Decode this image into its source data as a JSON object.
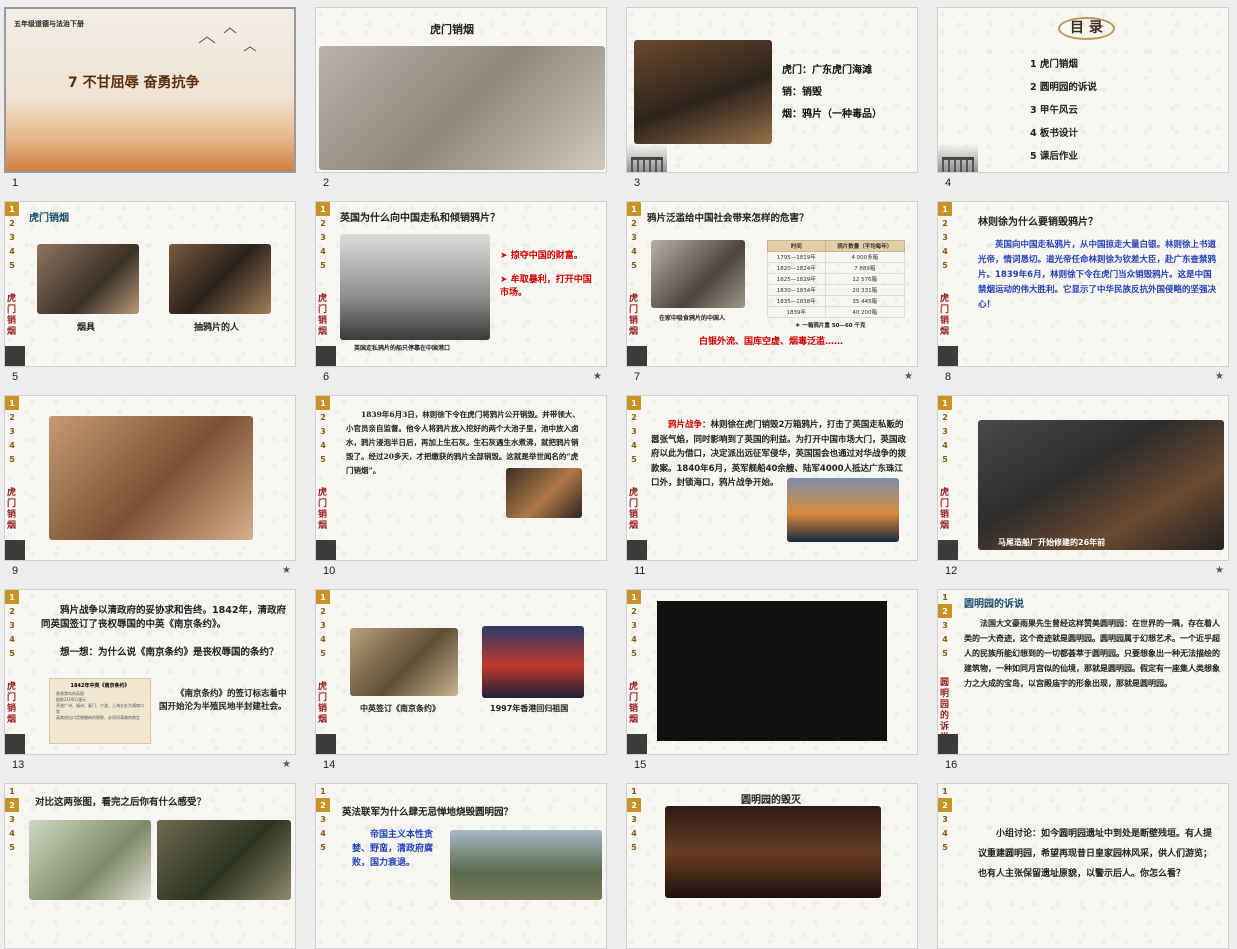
{
  "slides": [
    {
      "num": "1",
      "grade": "五年级道德与法治下册",
      "title": "7 不甘屈辱 奋勇抗争"
    },
    {
      "num": "2",
      "title": "虎门销烟"
    },
    {
      "num": "3",
      "lines": [
        "虎门：广东虎门海滩",
        "销：销毁",
        "烟：鸦片（一种毒品）"
      ]
    },
    {
      "num": "4",
      "title": "目 录",
      "items": [
        "1 虎门销烟",
        "2 圆明园的诉说",
        "3 甲午风云",
        "4 板书设计",
        "5 课后作业"
      ]
    },
    {
      "num": "5",
      "section": "虎门销烟",
      "cap1": "烟具",
      "cap2": "抽鸦片的人",
      "vtitle": "虎门销烟"
    },
    {
      "num": "6",
      "question": "英国为什么向中国走私和倾销鸦片？",
      "b1": "掠夺中国的财富。",
      "b2": "牟取暴利，打开中国市场。",
      "caption": "英国走私鸦片的船只停靠在中国港口",
      "vtitle": "虎门销烟"
    },
    {
      "num": "7",
      "question": "鸦片泛滥给中国社会带来怎样的危害？",
      "caption": "在家中吸食鸦片的中国人",
      "table_head": [
        "时间",
        "鸦片数量（平均每年）"
      ],
      "table_rows": [
        [
          "1795—1819年",
          "4 000多箱"
        ],
        [
          "1820—1824年",
          "7 889箱"
        ],
        [
          "1825—1829年",
          "12 576箱"
        ],
        [
          "1830—1834年",
          "20 331箱"
        ],
        [
          "1835—1838年",
          "35 445箱"
        ],
        [
          "1839年",
          "40 200箱"
        ]
      ],
      "note": "＊ 一箱鸦片重 50—60 千克",
      "harm": "白银外流、国库空虚、烟毒泛滥……",
      "vtitle": "虎门销烟"
    },
    {
      "num": "8",
      "question": "林则徐为什么要销毁鸦片？",
      "body": "英国向中国走私鸦片，从中国掠走大量白银。林则徐上书道光帝，情词恳切。道光帝任命林则徐为钦差大臣，赴广东查禁鸦片。1839年6月，林则徐下令在虎门当众销毁鸦片。这是中国禁烟运动的伟大胜利。它显示了中华民族反抗外国侵略的坚强决心！",
      "vtitle": "虎门销烟"
    },
    {
      "num": "9",
      "vtitle": "虎门销烟"
    },
    {
      "num": "10",
      "body": "1839年6月3日，林则徐下令在虎门将鸦片公开销毁。并带领大、小官员亲自监督。他令人将鸦片放入挖好的两个大池子里，池中放入卤水，鸦片浸泡半日后，再加上生石灰。生石灰遇生水煮沸，就把鸦片销毁了。经过20多天，才把缴获的鸦片全部销毁。这就是举世闻名的“虎门销烟”。",
      "vtitle": "虎门销烟"
    },
    {
      "num": "11",
      "lead": "鸦片战争",
      "body": "：林则徐在虎门销毁2万箱鸦片，打击了英国走私贩的嚣张气焰，同时影响到了英国的利益。为打开中国市场大门，英国政府以此为借口，决定派出远征军侵华，英国国会也通过对华战争的拨款案。1840年6月，英军舰船40余艘、陆军4000人抵达广东珠江口外，封锁海口，鸦片战争开始。",
      "vtitle": "虎门销烟"
    },
    {
      "num": "12",
      "caption": "马尾造船厂开始修建的26年前",
      "vtitle": "虎门销烟"
    },
    {
      "num": "13",
      "body": "鸦片战争以清政府的妥协求和告终。1842年，清政府同英国签订了丧权辱国的中英《南京条约》。",
      "think": "想一想：为什么说《南京条约》是丧权辱国的条约？",
      "doc_title": "1842年中英《南京条约》",
      "doc_lines": [
        "割香港岛给英国",
        "赔款2100万银元",
        "开放广州、福州、厦门、宁波、上海五处为通商口岸",
        "英商进出口货物缴纳的税款，必须同清政府商定"
      ],
      "side": "《南京条约》的签订标志着中国开始沦为半殖民地半封建社会。",
      "vtitle": "虎门销烟"
    },
    {
      "num": "14",
      "cap1": "中英签订《南京条约》",
      "cap2": "1997年香港回归祖国",
      "vtitle": "虎门销烟"
    },
    {
      "num": "15",
      "vtitle": "虎门销烟"
    },
    {
      "num": "16",
      "section": "圆明园的诉说",
      "body": "法国大文豪雨果先生曾经这样赞美圆明园：在世界的一隅，存在着人类的一大奇迹，这个奇迹就是圆明园。圆明园属于幻想艺术。一个近乎超人的民族所能幻想到的一切都荟萃于圆明园。只要想象出一种无法描绘的建筑物，一种如同月宫似的仙境，那就是圆明园。假定有一座集人类想象力之大成的宝岛，以宫殿庙宇的形象出现，那就是圆明园。",
      "vtitle": "圆明园的诉说"
    },
    {
      "num": "17",
      "question": "对比这两张图，看完之后你有什么感受？"
    },
    {
      "num": "18",
      "question": "英法联军为什么肆无忌惮地烧毁圆明园？",
      "body": "帝国主义本性贪婪、野蛮，清政府腐败，国力衰退。"
    },
    {
      "num": "19",
      "title": "圆明园的毁灭"
    },
    {
      "num": "20",
      "body": "小组讨论：如今圆明园遗址中到处是断壁残垣。有人提议重建圆明园，希望再现昔日皇家园林风采，供人们游览；也有人主张保留遗址原貌，以警示后人。你怎么看？"
    }
  ],
  "side_numbers": [
    "1",
    "2",
    "3",
    "4",
    "5"
  ],
  "star_icon": "★"
}
